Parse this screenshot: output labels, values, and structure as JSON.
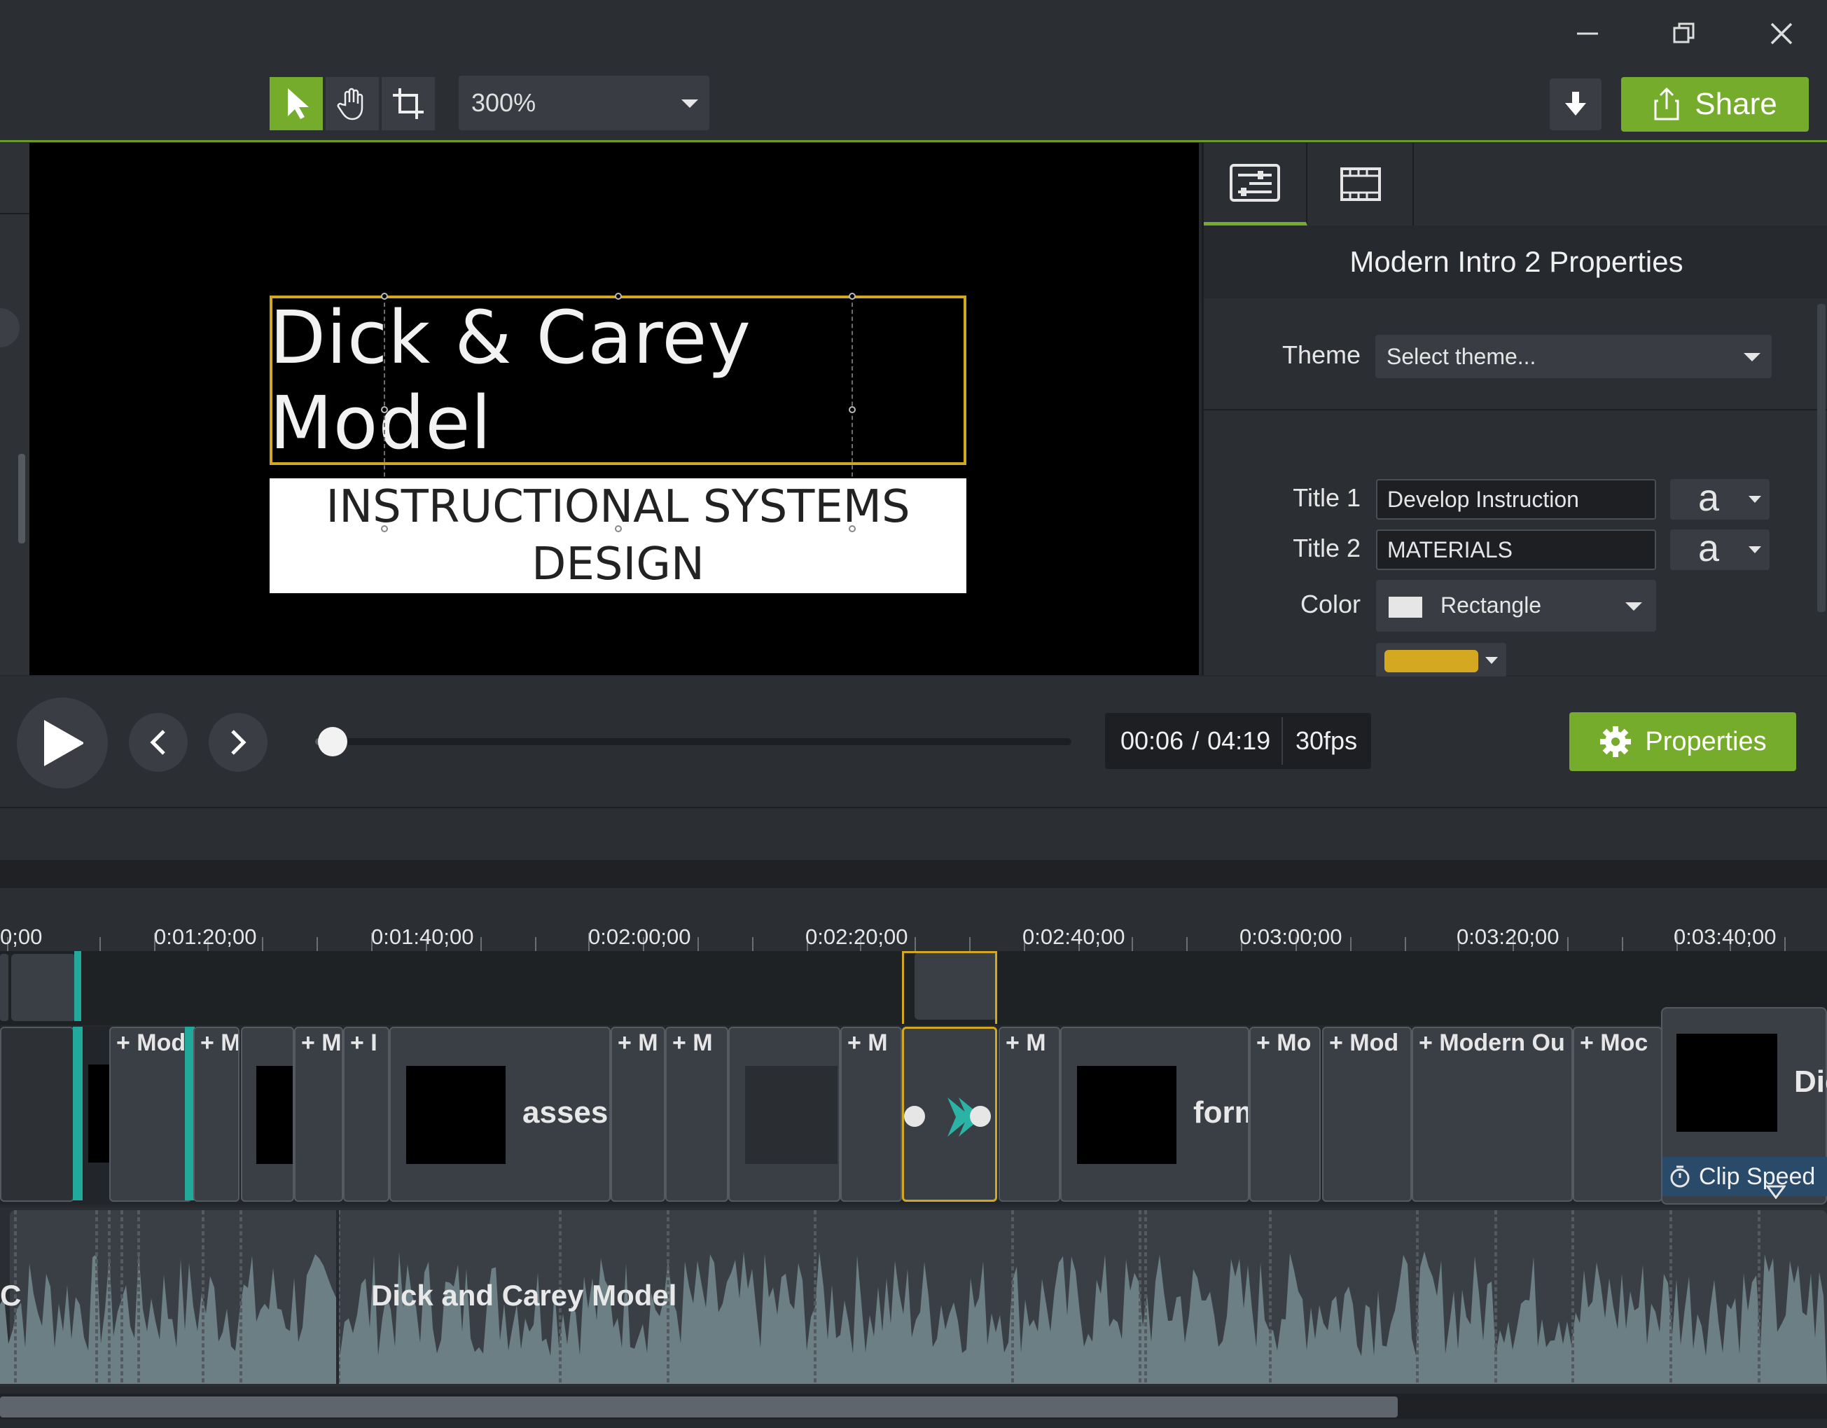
{
  "window": {
    "minimize_icon": "minimize-icon",
    "restore_icon": "restore-icon",
    "close_icon": "close-icon"
  },
  "toolbar": {
    "zoom": "300%",
    "share_label": "Share",
    "accent": "#76ac2c"
  },
  "canvas": {
    "title": "Dick & Carey Model",
    "subtitle_line1": "INSTRUCTIONAL SYSTEMS",
    "subtitle_line2": "DESIGN",
    "selection_color": "#d1a81f"
  },
  "properties": {
    "heading": "Modern Intro 2 Properties",
    "theme_label": "Theme",
    "theme_value": "Select theme...",
    "title1_label": "Title 1",
    "title1_value": "Develop Instruction",
    "title2_label": "Title 2",
    "title2_value": "MATERIALS",
    "font_glyph": "a",
    "color_label": "Color",
    "color_target": "Rectangle",
    "swatch_color": "#d4a820"
  },
  "playback": {
    "current_time": "00:06",
    "separator": "/",
    "duration": "04:19",
    "fps": "30fps",
    "properties_button": "Properties",
    "progress": 0.023
  },
  "ruler": {
    "labels": [
      "0;00",
      "0:01:20;00",
      "0:01:40;00",
      "0:02:00;00",
      "0:02:20;00",
      "0:02:40;00",
      "0:03:00;00",
      "0:03:20;00",
      "0:03:40;00"
    ]
  },
  "clips": {
    "c1": "+ Mod",
    "c2": "+ M",
    "c3": "+ M",
    "c4": "+ I",
    "c5_text": "assess",
    "c6": "+ M",
    "c7": "+ M",
    "c8": "+ M",
    "c9": "+ M",
    "c10_text": "form",
    "c11": "+ Mo",
    "c12": "+ Mod",
    "c13": "+ Modern Ou",
    "c14": "+ Moc",
    "tooltip_clip_text": "Dic",
    "clip_speed": "Clip Speed"
  },
  "audio": {
    "left_label": "C",
    "label": "Dick and Carey Model"
  }
}
